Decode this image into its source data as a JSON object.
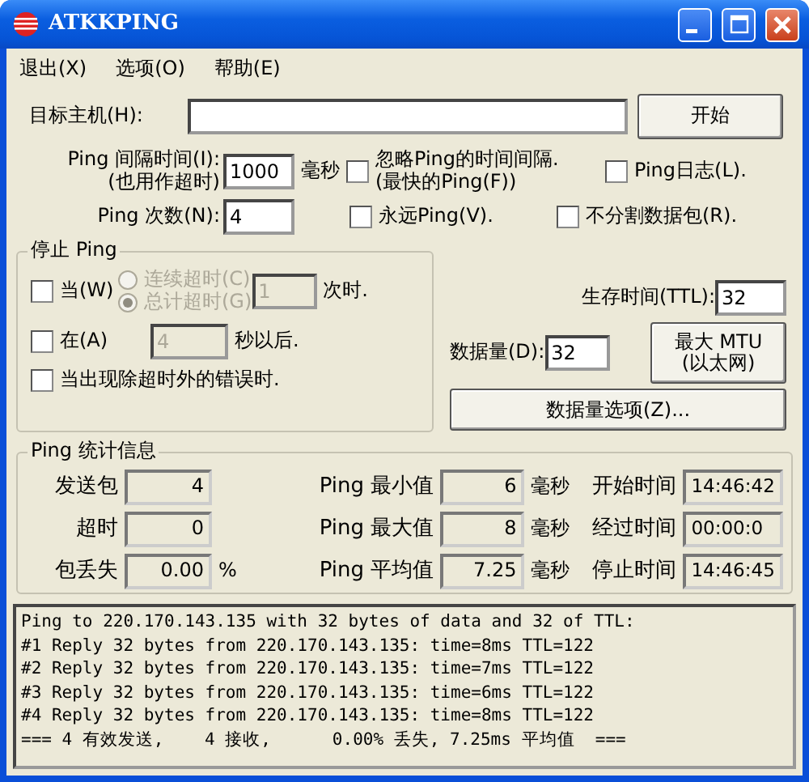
{
  "window": {
    "title": "ATKKPING"
  },
  "menu": [
    {
      "label": "退出(X)"
    },
    {
      "label": "选项(O)"
    },
    {
      "label": "帮助(E)"
    }
  ],
  "target": {
    "label": "目标主机(H):"
  },
  "start_button": "开始",
  "interval": {
    "label": "Ping 间隔时间(I):",
    "sublabel": "(也用作超时)",
    "value": "1000",
    "unit": "毫秒"
  },
  "count": {
    "label": "Ping 次数(N):",
    "value": "4"
  },
  "options": [
    {
      "label": "忽略Ping的时间间隔.",
      "sublabel": "(最快的Ping(F))",
      "checked": false
    },
    {
      "label": "Ping日志(L).",
      "checked": false
    },
    {
      "label": "永远Ping(V).",
      "checked": false
    },
    {
      "label": "不分割数据包(R).",
      "checked": false
    }
  ],
  "stop_group": {
    "title": "停止 Ping",
    "when": {
      "label": "当(W)",
      "checked": false
    },
    "radios": [
      {
        "label": "连续超时(C)",
        "selected": false,
        "disabled": true
      },
      {
        "label": "总计超时(G)",
        "selected": true,
        "disabled": true
      }
    ],
    "times": {
      "value": "1",
      "disabled": true,
      "suffix": "次时."
    },
    "after": {
      "label": "在(A)",
      "checked": false,
      "value": "4",
      "disabled": true,
      "suffix": "秒以后."
    },
    "on_error": {
      "label": "当出现除超时外的错误时.",
      "checked": false
    }
  },
  "ttl": {
    "label": "生存时间(TTL):",
    "value": "32"
  },
  "size": {
    "label": "数据量(D):",
    "value": "32"
  },
  "mtu_button": [
    "最大 MTU",
    "(以太网)"
  ],
  "size_options_button": "数据量选项(Z)...",
  "stats": {
    "title": "Ping  统计信息",
    "columns": [
      [
        {
          "label": "发送包",
          "value": "4"
        },
        {
          "label": "超时",
          "value": "0"
        },
        {
          "label": "包丢失",
          "value": "0.00",
          "unit": "%"
        }
      ],
      [
        {
          "label": "Ping 最小值",
          "value": "6",
          "unit": "毫秒"
        },
        {
          "label": "Ping 最大值",
          "value": "8",
          "unit": "毫秒"
        },
        {
          "label": "Ping 平均值",
          "value": "7.25",
          "unit": "毫秒"
        }
      ],
      [
        {
          "label": "开始时间",
          "value": "14:46:42"
        },
        {
          "label": "经过时间",
          "value": "00:00:0"
        },
        {
          "label": "停止时间",
          "value": "14:46:45"
        }
      ]
    ]
  },
  "log": [
    "Ping to 220.170.143.135 with 32 bytes of data and 32 of TTL:",
    "#1 Reply 32 bytes from 220.170.143.135: time=8ms TTL=122",
    "#2 Reply 32 bytes from 220.170.143.135: time=7ms TTL=122",
    "#3 Reply 32 bytes from 220.170.143.135: time=6ms TTL=122",
    "#4 Reply 32 bytes from 220.170.143.135: time=8ms TTL=122",
    "=== 4 有效发送,    4 接收,      0.00% 丢失, 7.25ms 平均值  ==="
  ]
}
